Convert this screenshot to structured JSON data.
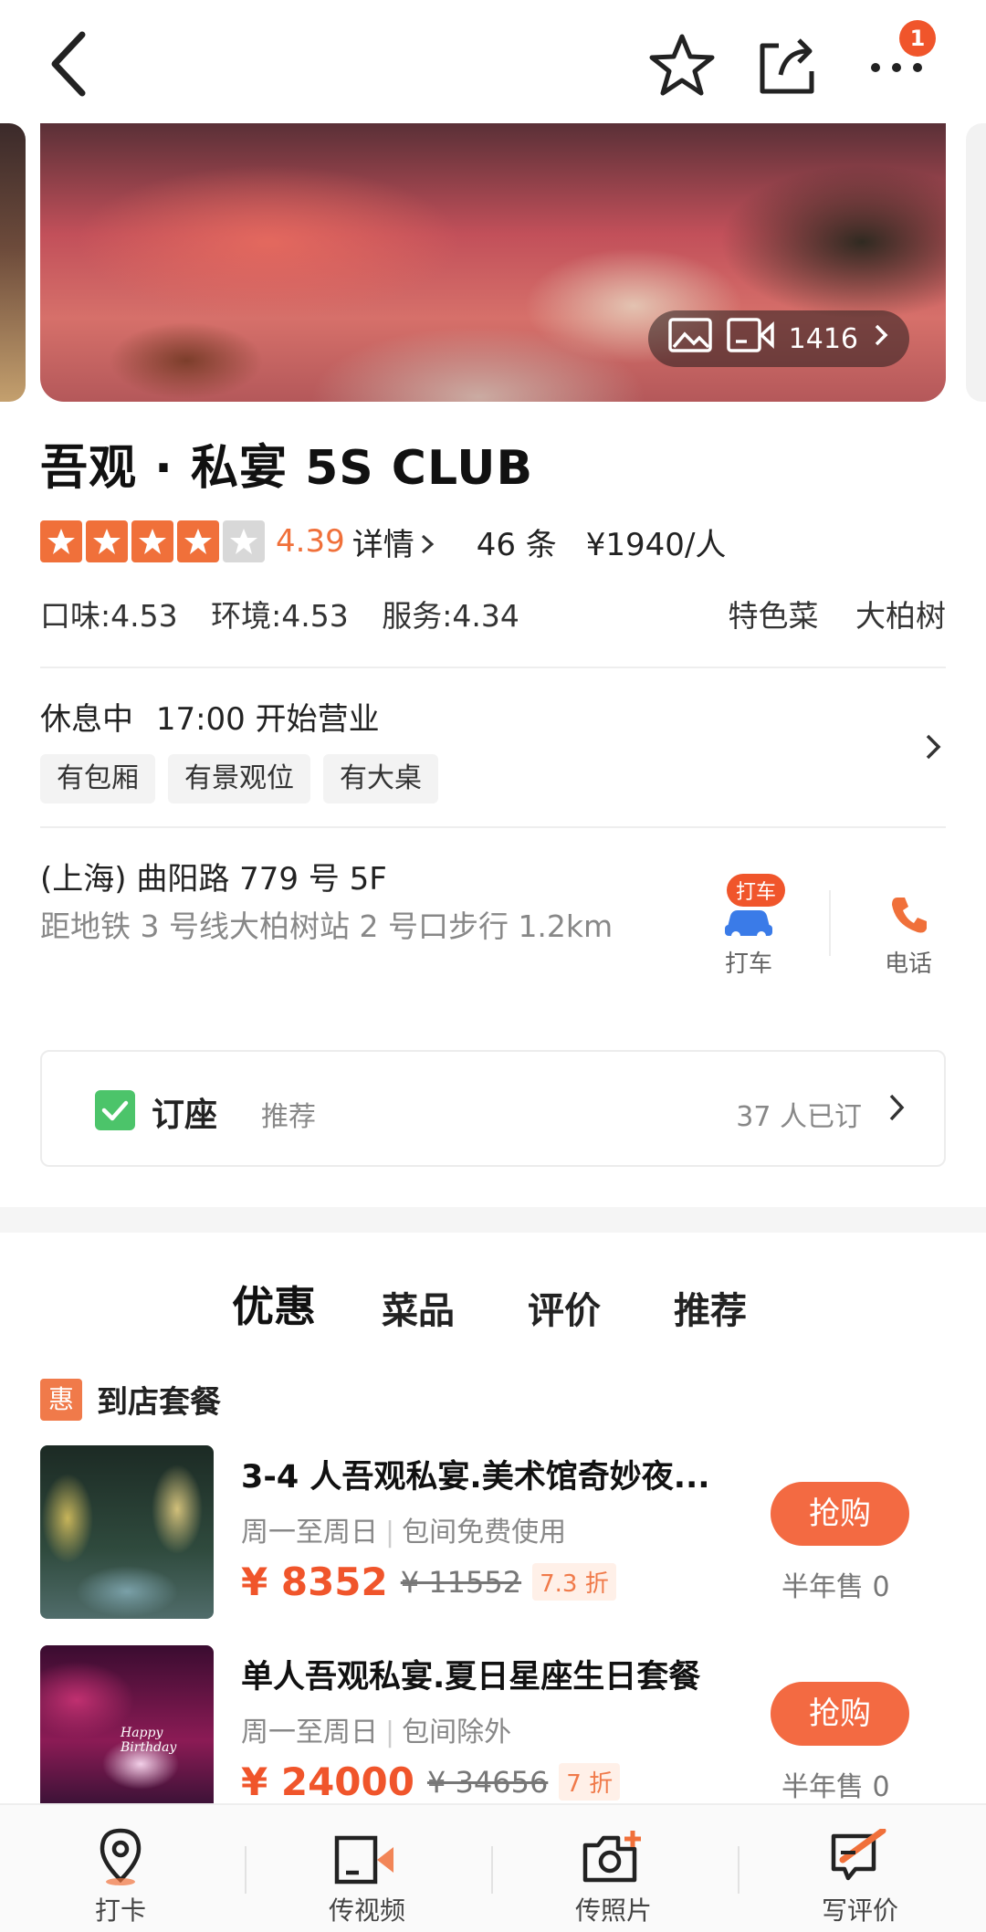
{
  "header": {
    "notification_count": "1"
  },
  "hero": {
    "media_count": "1416"
  },
  "restaurant": {
    "name": "吾观 · 私宴 5S CLUB",
    "rating_stars": 4.39,
    "rating_score": "4.39",
    "detail_link": "详情",
    "review_count": "46 条",
    "avg_price": "¥1940/人",
    "scores": {
      "taste": "口味:4.53",
      "env": "环境:4.53",
      "service": "服务:4.34"
    },
    "right_tags": [
      "特色菜",
      "大柏树"
    ]
  },
  "hours": {
    "status": "休息中",
    "open_time": "17:00 开始营业"
  },
  "facility_tags": [
    "有包厢",
    "有景观位",
    "有大桌"
  ],
  "address": {
    "line1": "(上海) 曲阳路 779 号 5F",
    "line2": "距地铁 3 号线大柏树站 2 号口步行 1.2km"
  },
  "actions": {
    "taxi_tag": "打车",
    "taxi": "打车",
    "phone": "电话"
  },
  "booking": {
    "label": "订座",
    "recommend": "推荐",
    "count": "37 人已订"
  },
  "tabs": [
    "优惠",
    "菜品",
    "评价",
    "推荐"
  ],
  "section": {
    "badge": "惠",
    "title": "到店套餐"
  },
  "deals": [
    {
      "name": "3-4 人吾观私宴.美术馆奇妙夜...",
      "meta1": "周一至周日",
      "meta2": "包间免费使用",
      "price_now": "¥ 8352",
      "price_was": "¥ 11552",
      "discount": "7.3 折",
      "buy": "抢购",
      "sold": "半年售 0"
    },
    {
      "name": "单人吾观私宴.夏日星座生日套餐",
      "meta1": "周一至周日",
      "meta2": "包间除外",
      "price_now": "¥ 24000",
      "price_was": "¥ 34656",
      "discount": "7 折",
      "buy": "抢购",
      "sold": "半年售 0",
      "thumb_text": "Happy Birthday"
    }
  ],
  "bottom_nav": [
    {
      "label": "打卡",
      "icon": "location-pin-icon"
    },
    {
      "label": "传视频",
      "icon": "video-upload-icon"
    },
    {
      "label": "传照片",
      "icon": "camera-add-icon"
    },
    {
      "label": "写评价",
      "icon": "write-review-icon"
    }
  ],
  "colors": {
    "accent": "#f0703a",
    "price": "#f0552b",
    "book_check": "#4cc46a"
  }
}
